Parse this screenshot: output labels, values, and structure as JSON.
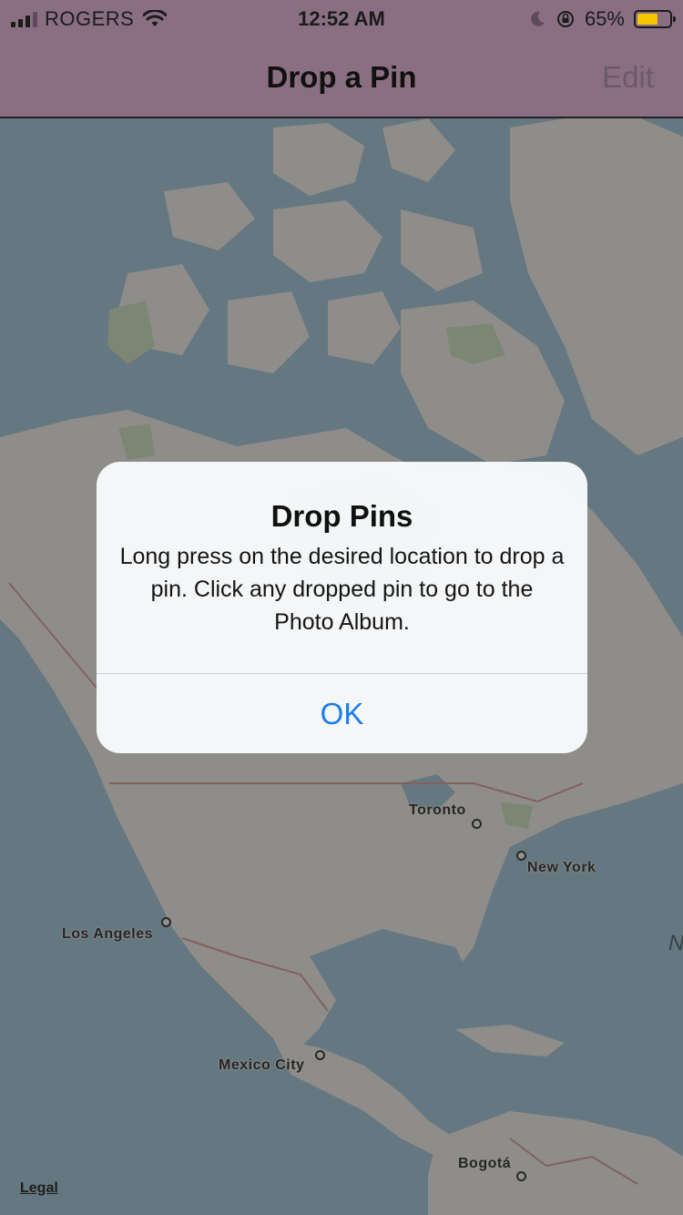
{
  "status_bar": {
    "carrier": "ROGERS",
    "time": "12:52 AM",
    "battery_percent": "65%",
    "battery_level": 0.65,
    "icons": [
      "signal-icon",
      "wifi-icon",
      "moon-icon",
      "orientation-lock-icon",
      "battery-icon"
    ]
  },
  "nav": {
    "title": "Drop a Pin",
    "edit_label": "Edit"
  },
  "map": {
    "cities": [
      {
        "name": "Toronto"
      },
      {
        "name": "New York"
      },
      {
        "name": "Los Angeles"
      },
      {
        "name": "Mexico City"
      },
      {
        "name": "Bogotá"
      }
    ],
    "legal_label": "Legal",
    "edge_letter": "N"
  },
  "alert": {
    "title": "Drop Pins",
    "message": "Long press on the desired location to drop a pin. Click any dropped pin to go to the Photo Album.",
    "ok_label": "OK"
  },
  "colors": {
    "bar_background": "#8a6f82",
    "accent": "#1a7df0",
    "battery_fill": "#f5c600"
  }
}
